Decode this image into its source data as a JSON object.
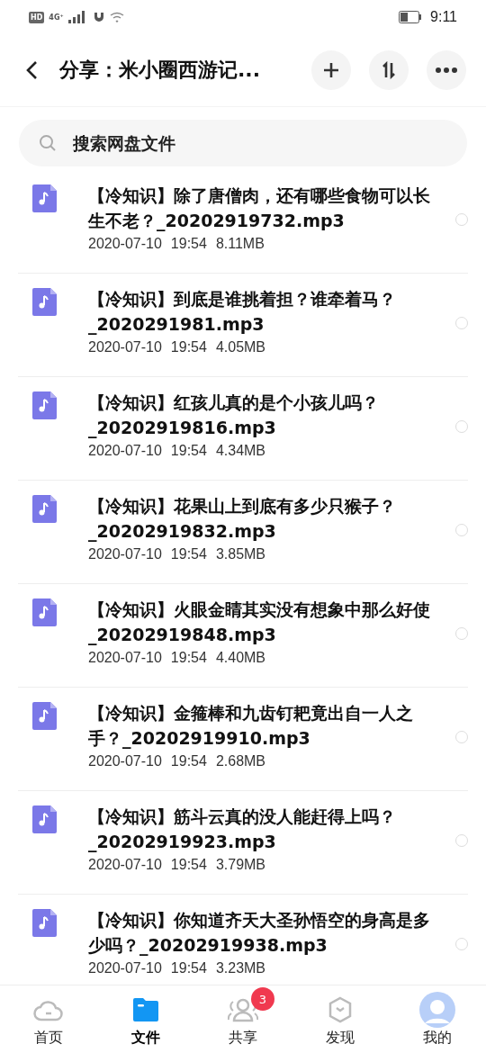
{
  "status_bar": {
    "time": "9:11",
    "network": "4G⁺",
    "hd": "HD"
  },
  "header": {
    "title": "分享：米小圈西游记..."
  },
  "search": {
    "placeholder": "搜索网盘文件"
  },
  "files": [
    {
      "name": "【冷知识】除了唐僧肉，还有哪些食物可以长生不老？_20202919732.mp3",
      "date": "2020-07-10",
      "time": "19:54",
      "size": "8.11MB",
      "selected": false
    },
    {
      "name": "【冷知识】到底是谁挑着担？谁牵着马？_2020291981.mp3",
      "date": "2020-07-10",
      "time": "19:54",
      "size": "4.05MB",
      "selected": false
    },
    {
      "name": "【冷知识】红孩儿真的是个小孩儿吗？_20202919816.mp3",
      "date": "2020-07-10",
      "time": "19:54",
      "size": "4.34MB",
      "selected": false
    },
    {
      "name": "【冷知识】花果山上到底有多少只猴子？_20202919832.mp3",
      "date": "2020-07-10",
      "time": "19:54",
      "size": "3.85MB",
      "selected": false
    },
    {
      "name": "【冷知识】火眼金睛其实没有想象中那么好使_20202919848.mp3",
      "date": "2020-07-10",
      "time": "19:54",
      "size": "4.40MB",
      "selected": false
    },
    {
      "name": "【冷知识】金箍棒和九齿钉耙竟出自一人之手？_20202919910.mp3",
      "date": "2020-07-10",
      "time": "19:54",
      "size": "2.68MB",
      "selected": false
    },
    {
      "name": "【冷知识】筋斗云真的没人能赶得上吗？_20202919923.mp3",
      "date": "2020-07-10",
      "time": "19:54",
      "size": "3.79MB",
      "selected": false
    },
    {
      "name": "【冷知识】你知道齐天大圣孙悟空的身高是多少吗？_20202919938.mp3",
      "date": "2020-07-10",
      "time": "19:54",
      "size": "3.23MB",
      "selected": false
    }
  ],
  "tabs": [
    {
      "label": "首页",
      "kind": "cloud",
      "selected": false
    },
    {
      "label": "文件",
      "kind": "folder",
      "selected": true
    },
    {
      "label": "共享",
      "kind": "people",
      "selected": false,
      "badge": "3"
    },
    {
      "label": "发现",
      "kind": "hexagon",
      "selected": false
    },
    {
      "label": "我的",
      "kind": "avatar",
      "selected": false
    }
  ]
}
